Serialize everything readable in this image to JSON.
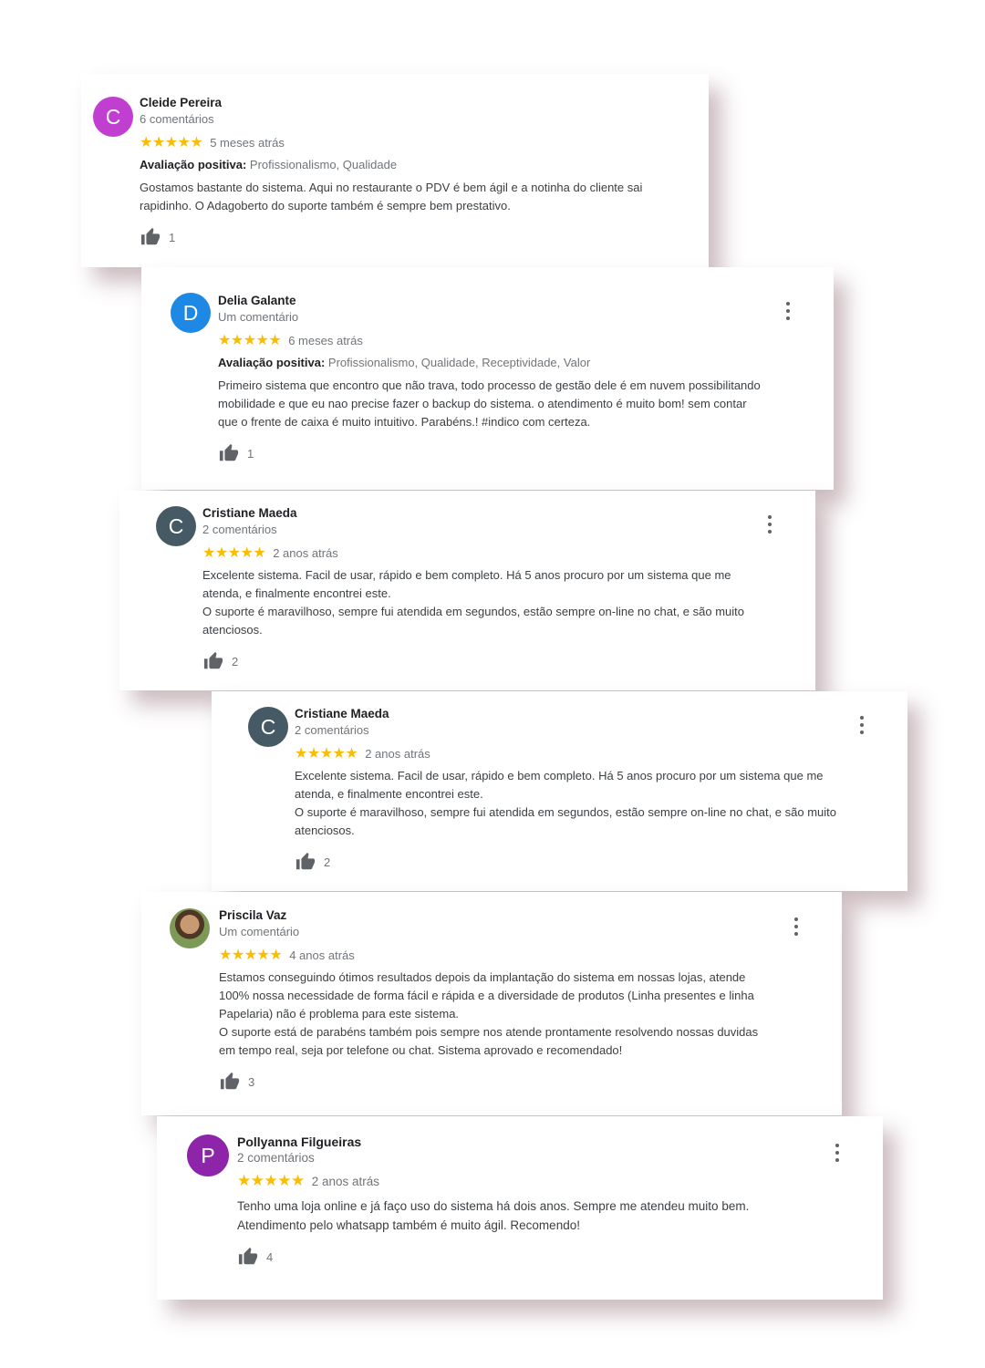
{
  "reviews": [
    {
      "avatar_letter": "C",
      "avatar_color": "#c13fd0",
      "name": "Cleide Pereira",
      "count": "6 comentários",
      "stars": "★★★★★",
      "time": "5 meses atrás",
      "positive_label": "Avaliação positiva:",
      "positive_value": "Profissionalismo, Qualidade",
      "text": "Gostamos bastante do sistema. Aqui no restaurante o PDV é bem ágil e a notinha do cliente sai\nrapidinho. O Adagoberto do suporte também é sempre bem prestativo.",
      "likes": "1"
    },
    {
      "avatar_letter": "D",
      "avatar_color": "#1e88e5",
      "name": "Delia Galante",
      "count": "Um comentário",
      "stars": "★★★★★",
      "time": "6 meses atrás",
      "positive_label": "Avaliação positiva:",
      "positive_value": "Profissionalismo, Qualidade, Receptividade, Valor",
      "text": "Primeiro sistema que encontro que não trava, todo processo de gestão dele é em nuvem  possibilitando\nmobilidade e que eu nao precise fazer o backup do sistema. o atendimento é muito bom! sem contar\nque o frente de caixa é muito intuitivo.  Parabéns.! #indico com certeza.",
      "likes": "1"
    },
    {
      "avatar_letter": "C",
      "avatar_color": "#455a64",
      "name": "Cristiane Maeda",
      "count": "2 comentários",
      "stars": "★★★★★",
      "time": "2 anos atrás",
      "text": "Excelente sistema. Facil de usar, rápido e bem completo. Há 5 anos procuro por um sistema que me\natenda, e finalmente encontrei este.\nO suporte é maravilhoso, sempre fui atendida em segundos, estão sempre on-line no chat, e são muito\natenciosos.",
      "likes": "2"
    },
    {
      "avatar_letter": "C",
      "avatar_color": "#455a64",
      "name": "Cristiane Maeda",
      "count": "2 comentários",
      "stars": "★★★★★",
      "time": "2 anos atrás",
      "text": "Excelente sistema. Facil de usar, rápido e bem completo. Há 5 anos procuro por um sistema que me\natenda, e finalmente encontrei este.\nO suporte é maravilhoso, sempre fui atendida em segundos, estão sempre on-line no chat, e são muito\natenciosos.",
      "likes": "2"
    },
    {
      "avatar_letter": "",
      "avatar_color": "#7c9a56",
      "name": "Priscila Vaz",
      "count": "Um comentário",
      "stars": "★★★★★",
      "time": "4 anos atrás",
      "text": "Estamos conseguindo ótimos resultados depois da implantação do sistema em nossas lojas, atende\n100% nossa necessidade de forma fácil e rápida e a diversidade de produtos (Linha presentes e linha\nPapelaria) não é problema para este sistema.\nO suporte está de parabéns também pois sempre nos atende prontamente resolvendo nossas duvidas\nem tempo real, seja por telefone ou chat. Sistema aprovado e recomendado!",
      "likes": "3"
    },
    {
      "avatar_letter": "P",
      "avatar_color": "#8e24aa",
      "name": "Pollyanna Filgueiras",
      "count": "2 comentários",
      "stars": "★★★★★",
      "time": "2 anos atrás",
      "text": "Tenho uma loja online e já faço uso do sistema há dois anos. Sempre me atendeu muito bem.\nAtendimento pelo whatsapp também é muito ágil. Recomendo!",
      "likes": "4"
    }
  ],
  "icons": {
    "like": "thumbs-up-icon",
    "menu": "more-vert-icon",
    "star": "star-icon"
  }
}
